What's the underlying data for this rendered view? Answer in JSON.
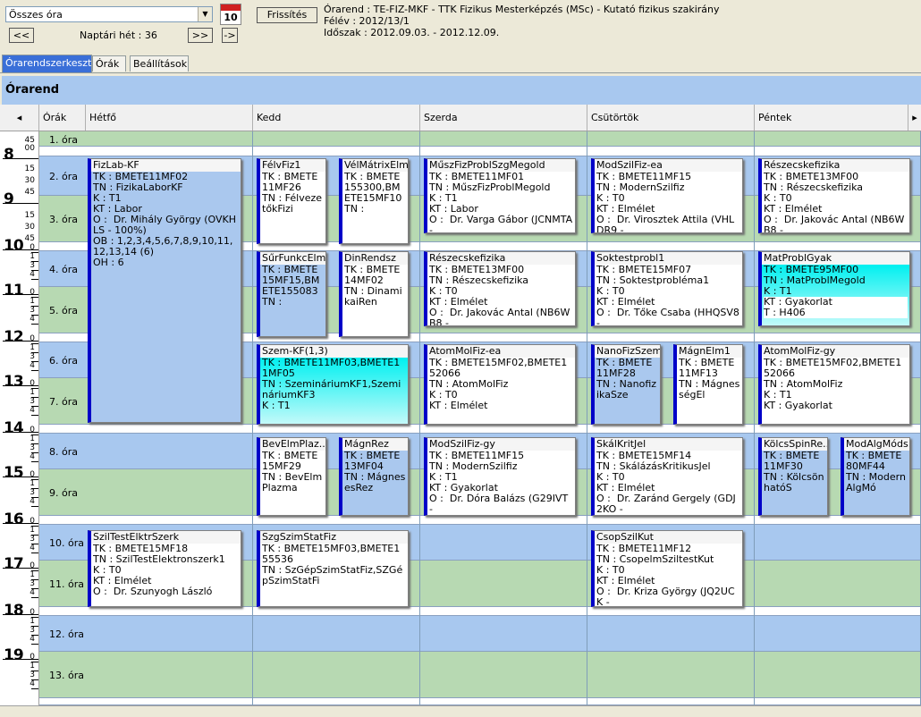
{
  "toolbar": {
    "view_select": "Összes óra",
    "calendar_day": "10",
    "refresh_label": "Frissítés",
    "prev_label": "<<",
    "next_label": ">>",
    "jump_label": "->",
    "week_label": "Naptári hét : 36"
  },
  "info": {
    "line1": "Órarend : TE-FIZ-MKF - TTK Fizikus Mesterképzés (MSc) - Kutató fizikus szakirány",
    "line2": "Félév : 2012/13/1",
    "line3": "Időszak : 2012.09.03. - 2012.12.09."
  },
  "tabs": [
    "Órarendszerkesztő",
    "Órák",
    "Beállítások"
  ],
  "schedule_title": "Órarend",
  "columns": {
    "scroll_left": "◂",
    "scroll_right": "▸",
    "orak": "Órák",
    "days": [
      "Hétfő",
      "Kedd",
      "Szerda",
      "Csütörtök",
      "Péntek"
    ]
  },
  "time_labels": {
    "hours": [
      "8",
      "9",
      "10",
      "11",
      "12",
      "13",
      "14",
      "15",
      "16",
      "17",
      "18",
      "19"
    ],
    "quarter_a": [
      "45",
      "00",
      "15",
      "30",
      "45",
      "00",
      "15",
      "30",
      "45"
    ],
    "minor": [
      "0",
      "1",
      "3",
      "4"
    ]
  },
  "periods": [
    "1. óra",
    "2. óra",
    "3. óra",
    "4. óra",
    "5. óra",
    "6. óra",
    "7. óra",
    "8. óra",
    "9. óra",
    "10. óra",
    "11. óra",
    "12. óra",
    "13. óra"
  ],
  "events": {
    "e1": {
      "title": "FizLab-KF",
      "lines": [
        "TK : BMETE11MF02",
        "TN : FizikaLaborKF",
        "K : T1",
        "KT : Labor",
        "O :  Dr. Mihály György (OVKHLS - 100%)",
        "OB : 1,2,3,4,5,6,7,8,9,10,11,12,13,14 (6)",
        "OH : 6"
      ]
    },
    "e2": {
      "title": "SzilTestElktrSzerk",
      "lines": [
        "TK : BMETE15MF18",
        "TN : SzilTestElektronszerk1",
        "K : T0",
        "KT : Elmélet",
        "O :  Dr. Szunyogh László"
      ]
    },
    "e3": {
      "title": "FélvFiz1",
      "lines": [
        "TK : BMETE11MF26",
        "TN : FélvezetőkFizi"
      ]
    },
    "e4": {
      "title": "VélMátrixElm",
      "lines": [
        "TK : BMETE155300,BMETE15MF10",
        "TN :"
      ]
    },
    "e5": {
      "title": "SűrFunkcElm",
      "lines": [
        "TK : BMETE15MF15,BMETE155083",
        "TN :"
      ]
    },
    "e6": {
      "title": "DinRendsz",
      "lines": [
        "TK : BMETE14MF02",
        "TN : DinamikaiRen"
      ]
    },
    "e7": {
      "title": "Szem-KF(1,3)",
      "lines": [
        "TK : BMETE11MF03,BMETE11MF05",
        "TN : SzemináriumKF1,SzemináriumKF3",
        "K : T1"
      ]
    },
    "e8": {
      "title": "BevElmPlaz...",
      "lines": [
        "TK : BMETE15MF29",
        "TN : BevElmPlazma"
      ]
    },
    "e9": {
      "title": "MágnRez",
      "lines": [
        "TK : BMETE13MF04",
        "TN : MágnesesRez"
      ]
    },
    "e10": {
      "title": "SzgSzimStatFiz",
      "lines": [
        "TK : BMETE15MF03,BMETE155536",
        "TN : SzGépSzimStatFiz,SZGépSzimStatFi"
      ]
    },
    "e11": {
      "title": "MűszFizProblSzgMegold",
      "lines": [
        "TK : BMETE11MF01",
        "TN : MűszFizProblMegold",
        "K : T1",
        "KT : Labor",
        "O :  Dr. Varga Gábor (JCNMTA -"
      ]
    },
    "e12": {
      "title": "Részecskefizika",
      "lines": [
        "TK : BMETE13MF00",
        "TN : Részecskefizika",
        "K : T0",
        "KT : Elmélet",
        "O :  Dr. Jakovác Antal (NB6WB8 -"
      ]
    },
    "e13": {
      "title": "AtomMolFiz-ea",
      "lines": [
        "TK : BMETE15MF02,BMETE152066",
        "TN : AtomMolFiz",
        "K : T0",
        "KT : Elmélet"
      ]
    },
    "e14": {
      "title": "ModSzilFiz-gy",
      "lines": [
        "TK : BMETE11MF15",
        "TN : ModernSzilfiz",
        "K : T1",
        "KT : Gyakorlat",
        "O :  Dr. Dóra Balázs (G29IVT -"
      ]
    },
    "e15": {
      "title": "ModSzilFiz-ea",
      "lines": [
        "TK : BMETE11MF15",
        "TN : ModernSzilfiz",
        "K : T0",
        "KT : Elmélet",
        "O :  Dr. Virosztek Attila (VHLDR9 -"
      ]
    },
    "e16": {
      "title": "Soktestprobl1",
      "lines": [
        "TK : BMETE15MF07",
        "TN : Soktestprobléma1",
        "K : T0",
        "KT : Elmélet",
        "O :  Dr. Tőke Csaba (HHQSV8 -"
      ]
    },
    "e17": {
      "title": "NanoFizSzem2",
      "lines": [
        "TK : BMETE11MF28",
        "TN : NanofizikaSze"
      ]
    },
    "e18": {
      "title": "MágnElm1",
      "lines": [
        "TK : BMETE11MF13",
        "TN : MágnességEl"
      ]
    },
    "e19": {
      "title": "SkálKritJel",
      "lines": [
        "TK : BMETE15MF14",
        "TN : SkálázásKritikusJel",
        "K : T0",
        "KT : Elmélet",
        "O :  Dr. Zaránd Gergely (GDJ2KO -"
      ]
    },
    "e20": {
      "title": "CsopSzilKut",
      "lines": [
        "TK : BMETE11MF12",
        "TN : CsopelmSziltestKut",
        "K : T0",
        "KT : Elmélet",
        "O :  Dr. Kriza György (JQ2UCK -"
      ]
    },
    "e21": {
      "title": "Részecskefizika",
      "lines": [
        "TK : BMETE13MF00",
        "TN : Részecskefizika",
        "K : T0",
        "KT : Elmélet",
        "O :  Dr. Jakovác Antal (NB6WB8 -"
      ]
    },
    "e22": {
      "title": "MatProblGyak",
      "lines": [
        "TK : BMETE95MF00",
        "TN : MatProblMegold",
        "K : T1",
        "KT : Gyakorlat",
        "T : H406"
      ]
    },
    "e23": {
      "title": "AtomMolFiz-gy",
      "lines": [
        "TK : BMETE15MF02,BMETE152066",
        "TN : AtomMolFiz",
        "K : T1",
        "KT : Gyakorlat"
      ]
    },
    "e24": {
      "title": "KölcsSpinRe...",
      "lines": [
        "TK : BMETE11MF30",
        "TN : KölcsönhatóS"
      ]
    },
    "e25": {
      "title": "ModAlgMóds...",
      "lines": [
        "TK : BMETE80MF44",
        "TN : ModernAlgMó"
      ]
    }
  },
  "colors": {
    "blue_band": "#a8c8ef",
    "green_band": "#b7d9b2",
    "event_accent": "#0000c8",
    "cyan": "#00f0f0"
  }
}
